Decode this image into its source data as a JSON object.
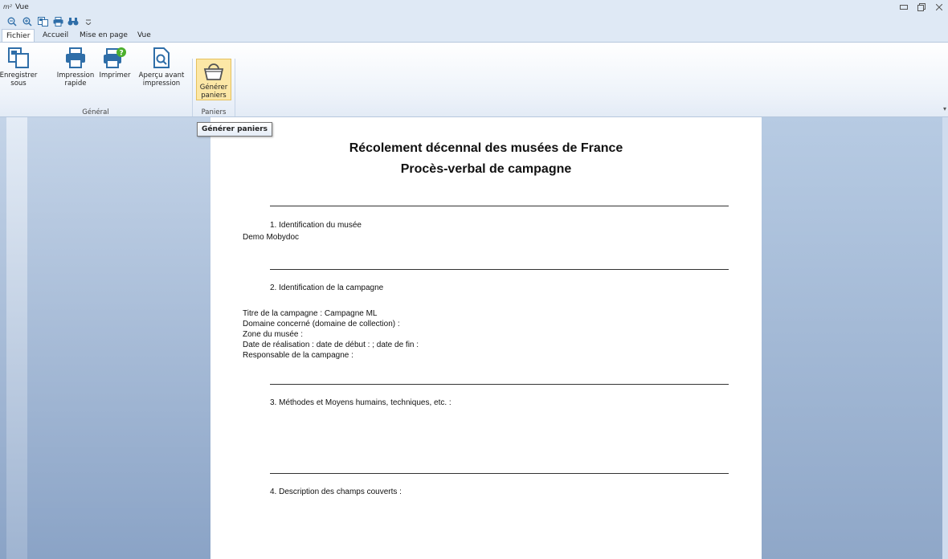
{
  "window": {
    "logo": "m²",
    "title": "Vue",
    "controls": [
      "minimize-icon",
      "restore-icon",
      "close-icon"
    ]
  },
  "quick_access": [
    "zoom-out-icon",
    "zoom-in-icon",
    "save-as-icon",
    "print-icon",
    "find-icon",
    "customize-qat-icon"
  ],
  "tabs": [
    {
      "label": "Fichier",
      "active": true
    },
    {
      "label": "Accueil",
      "active": false
    },
    {
      "label": "Mise en page",
      "active": false
    },
    {
      "label": "Vue",
      "active": false
    }
  ],
  "ribbon": {
    "general_group": {
      "label": "Général",
      "buttons": [
        {
          "label": "Enregistrer sous",
          "icon": "save-as-icon"
        },
        {
          "label": "Impression rapide",
          "icon": "quick-print-icon"
        },
        {
          "label": "Imprimer",
          "icon": "print-icon"
        },
        {
          "label": "Aperçu avant impression",
          "icon": "print-preview-icon"
        }
      ]
    },
    "paniers_group": {
      "label": "Paniers",
      "buttons": [
        {
          "label": "Générer paniers",
          "icon": "basket-icon",
          "highlighted": true
        }
      ]
    }
  },
  "tooltip": "Générer paniers",
  "document": {
    "title_line1": "Récolement décennal des musées de France",
    "title_line2": "Procès-verbal de campagne",
    "section1": {
      "heading": "1. Identification du musée",
      "value": "Demo Mobydoc"
    },
    "section2": {
      "heading": "2. Identification de la campagne",
      "lines": [
        "Titre de la campagne : Campagne ML",
        "Domaine concerné (domaine de collection) :",
        "Zone du musée :",
        "Date de réalisation : date de début :  ; date de fin :",
        "Responsable de la campagne :"
      ]
    },
    "section3": {
      "heading": "3. Méthodes et Moyens humains, techniques, etc. :"
    },
    "section4": {
      "heading": "4. Description des champs couverts :"
    }
  },
  "colors": {
    "accent_highlight": "#fce7a6",
    "icon_blue": "#2f6ea8",
    "workspace_blue": "#8fa7c8"
  }
}
